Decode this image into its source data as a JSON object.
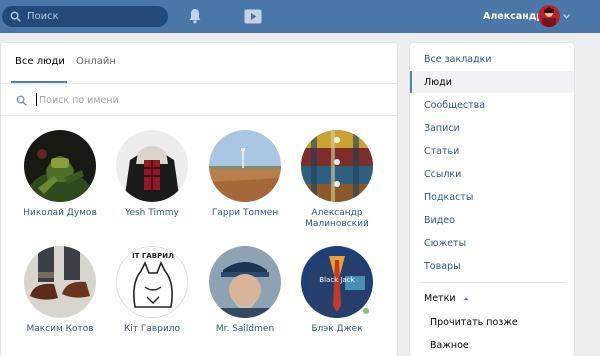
{
  "header": {
    "search_placeholder": "Поиск",
    "user_name": "Александр",
    "icons": [
      "search-icon",
      "bell-icon",
      "play-icon",
      "chevron-down-icon"
    ]
  },
  "tabs": [
    {
      "label": "Все люди",
      "active": true
    },
    {
      "label": "Онлайн",
      "active": false
    }
  ],
  "people_search": {
    "placeholder": "Поиск по имени"
  },
  "people": [
    {
      "name": "Николай Думов",
      "online": false
    },
    {
      "name": "Yesh Timmy",
      "online": false
    },
    {
      "name": "Гарри Топмен",
      "online": false
    },
    {
      "name": "Александр Малиновский",
      "online": false
    },
    {
      "name": "Максим Котов",
      "online": false
    },
    {
      "name": "Кіт Гаврило",
      "online": false,
      "avatar_text": "ІТ ГАВРИЛ"
    },
    {
      "name": "Mr. Saildmen",
      "online": false
    },
    {
      "name": "Блэк Джек",
      "online": true,
      "avatar_text": "Black Jack"
    }
  ],
  "menu": {
    "items": [
      {
        "label": "Все закладки",
        "selected": false
      },
      {
        "label": "Люди",
        "selected": true
      },
      {
        "label": "Сообщества",
        "selected": false
      },
      {
        "label": "Записи",
        "selected": false
      },
      {
        "label": "Статьи",
        "selected": false
      },
      {
        "label": "Ссылки",
        "selected": false
      },
      {
        "label": "Подкасты",
        "selected": false
      },
      {
        "label": "Видео",
        "selected": false
      },
      {
        "label": "Сюжеты",
        "selected": false
      },
      {
        "label": "Товары",
        "selected": false
      }
    ],
    "tags_label": "Метки",
    "tags": [
      "Прочитать позже",
      "Важное"
    ]
  },
  "colors": {
    "header": "#4a76a8",
    "link": "#2a5885",
    "accent": "#5181b8",
    "online": "#8ac176"
  }
}
